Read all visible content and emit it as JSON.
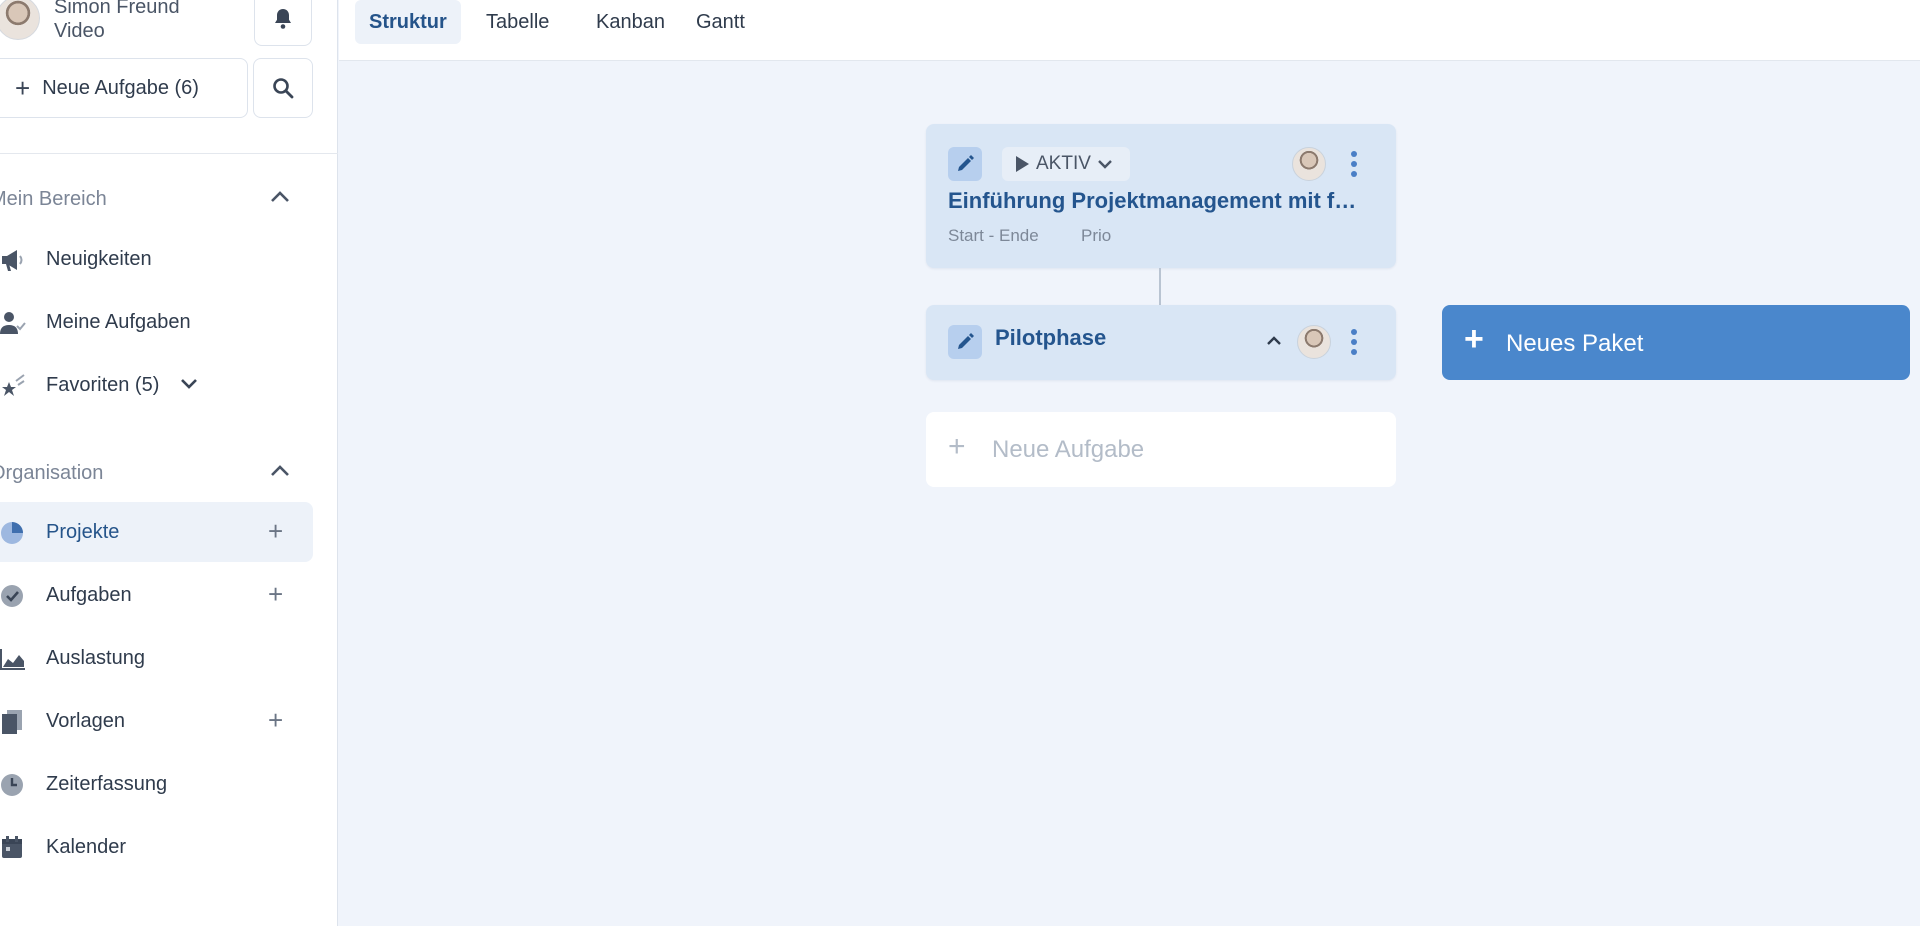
{
  "user": {
    "name": "Simon Freund",
    "subtitle": "Video"
  },
  "sidebar": {
    "new_task_label": "Neue Aufgabe (6)",
    "section_my_area": "Mein Bereich",
    "section_org": "Organisation",
    "my_items": [
      {
        "label": "Neuigkeiten",
        "icon": "megaphone-icon"
      },
      {
        "label": "Meine Aufgaben",
        "icon": "user-check-icon"
      },
      {
        "label": "Favoriten (5)",
        "icon": "star-icon"
      }
    ],
    "org_items": [
      {
        "label": "Projekte",
        "icon": "pie-chart-icon"
      },
      {
        "label": "Aufgaben",
        "icon": "check-circle-icon"
      },
      {
        "label": "Auslastung",
        "icon": "area-chart-icon"
      },
      {
        "label": "Vorlagen",
        "icon": "documents-icon"
      },
      {
        "label": "Zeiterfassung",
        "icon": "clock-icon"
      },
      {
        "label": "Kalender",
        "icon": "calendar-icon"
      }
    ]
  },
  "tabs": [
    "Struktur",
    "Tabelle",
    "Kanban",
    "Gantt"
  ],
  "project_card": {
    "status": "AKTIV",
    "title": "Einführung Projektmanagement mit f…",
    "dates": "Start - Ende",
    "prio": "Prio"
  },
  "phase_card": {
    "title": "Pilotphase"
  },
  "new_task_placeholder": "Neue Aufgabe",
  "new_package_label": "Neues Paket",
  "colors": {
    "accent": "#4a87cc",
    "card": "#d9e6f5",
    "title": "#24558e"
  }
}
